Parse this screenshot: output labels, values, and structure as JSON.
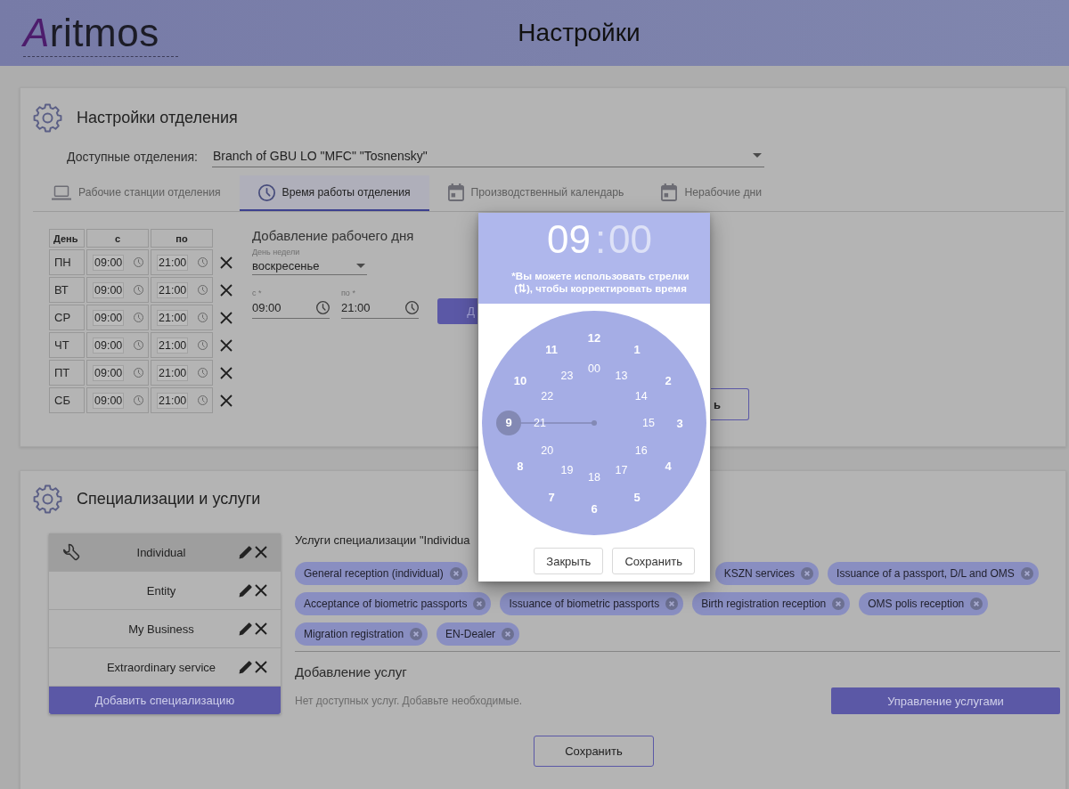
{
  "header": {
    "logo": "Aritmos",
    "title": "Настройки"
  },
  "branch_settings": {
    "title": "Настройки отделения",
    "branch_select": {
      "label": "Доступные отделения:",
      "value": "Branch of GBU LO \"MFC\" \"Tosnensky\""
    },
    "tabs": [
      {
        "label": "Рабочие станции отделения",
        "kind": "laptop",
        "selected": false
      },
      {
        "label": "Время работы отделения",
        "kind": "clock",
        "selected": true
      },
      {
        "label": "Производственный календарь",
        "kind": "calendar",
        "selected": false
      },
      {
        "label": "Нерабочие дни",
        "kind": "calendar",
        "selected": false
      }
    ],
    "schedule": {
      "columns": [
        "День",
        "с",
        "по"
      ],
      "rows": [
        {
          "day": "ПН",
          "from": "09:00",
          "to": "21:00"
        },
        {
          "day": "ВТ",
          "from": "09:00",
          "to": "21:00"
        },
        {
          "day": "СР",
          "from": "09:00",
          "to": "21:00"
        },
        {
          "day": "ЧТ",
          "from": "09:00",
          "to": "21:00"
        },
        {
          "day": "ПТ",
          "from": "09:00",
          "to": "21:00"
        },
        {
          "day": "СБ",
          "from": "09:00",
          "to": "21:00"
        }
      ]
    },
    "add_day": {
      "title": "Добавление рабочего дня",
      "weekday": {
        "label": "День недели",
        "value": "воскресенье"
      },
      "from": {
        "label": "с *",
        "value": "09:00"
      },
      "to": {
        "label": "по *",
        "value": "21:00"
      },
      "add_button": "Д",
      "partial_button": "ь"
    }
  },
  "specializations": {
    "title": "Специализации и услуги",
    "items": [
      {
        "label": "Individual",
        "selected": true
      },
      {
        "label": "Entity",
        "selected": false
      },
      {
        "label": "My Business",
        "selected": false
      },
      {
        "label": "Extraordinary service",
        "selected": false
      }
    ],
    "add_button": "Добавить специализацию",
    "services_title": "Услуги специализации \"Individua",
    "services": [
      "General reception (individual)",
      "KSZN services",
      "Issuance of a passport, D/L and OMS",
      "Acceptance of biometric passports",
      "Issuance of biometric passports",
      "Birth registration reception",
      "OMS polis reception",
      "Migration registration",
      "EN-Dealer"
    ],
    "add_services_title": "Добавление услуг",
    "empty_note": "Нет доступных услуг. Добавьте необходимые.",
    "manage_button": "Управление услугами",
    "save_button": "Сохранить"
  },
  "time_dialog": {
    "hours": {
      "text": "09",
      "selected": true
    },
    "separator": ":",
    "minutes": {
      "text": "00",
      "selected": false
    },
    "hint": "*Вы можете использовать стрелки (⇅), чтобы корректировать время",
    "clock": {
      "outer": [
        {
          "label": "12",
          "selected": false
        },
        {
          "label": "1",
          "selected": false
        },
        {
          "label": "2",
          "selected": false
        },
        {
          "label": "3",
          "selected": false
        },
        {
          "label": "4",
          "selected": false
        },
        {
          "label": "5",
          "selected": false
        },
        {
          "label": "6",
          "selected": false
        },
        {
          "label": "7",
          "selected": false
        },
        {
          "label": "8",
          "selected": false
        },
        {
          "label": "9",
          "selected": true
        },
        {
          "label": "10",
          "selected": false
        },
        {
          "label": "11",
          "selected": false
        }
      ],
      "inner": [
        {
          "label": "00",
          "selected": false
        },
        {
          "label": "13",
          "selected": false
        },
        {
          "label": "14",
          "selected": false
        },
        {
          "label": "15",
          "selected": false
        },
        {
          "label": "16",
          "selected": false
        },
        {
          "label": "17",
          "selected": false
        },
        {
          "label": "18",
          "selected": false
        },
        {
          "label": "19",
          "selected": false
        },
        {
          "label": "20",
          "selected": false
        },
        {
          "label": "21",
          "selected": false
        },
        {
          "label": "22",
          "selected": false
        },
        {
          "label": "23",
          "selected": false
        }
      ]
    },
    "buttons": [
      "Закрыть",
      "Сохранить"
    ]
  }
}
